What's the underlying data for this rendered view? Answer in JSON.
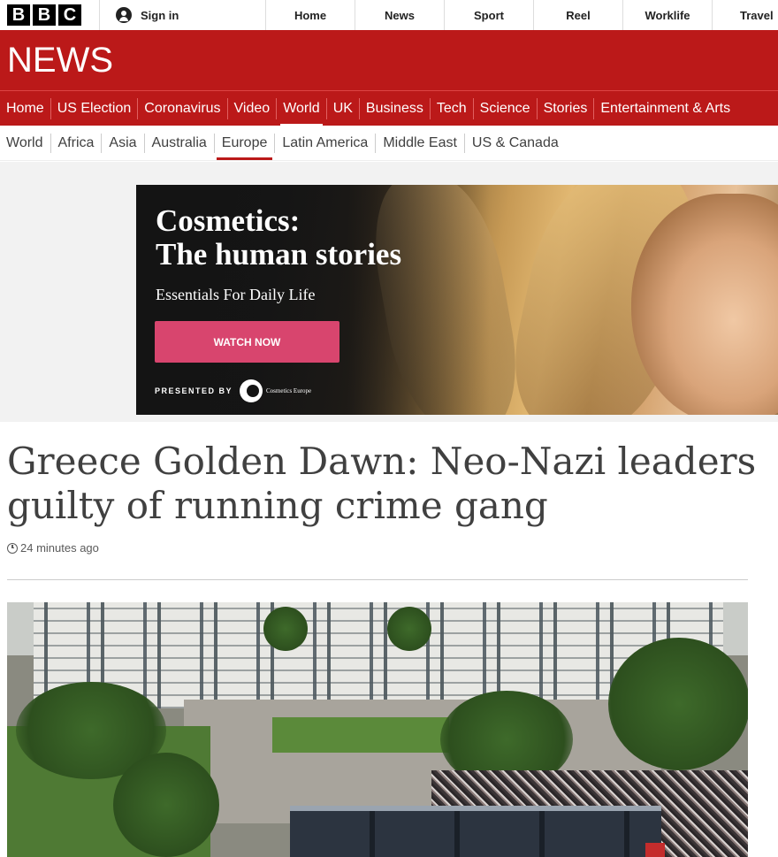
{
  "brand": {
    "letters": [
      "B",
      "B",
      "C"
    ]
  },
  "top_bar": {
    "sign_in": "Sign in",
    "nav": [
      "Home",
      "News",
      "Sport",
      "Reel",
      "Worklife",
      "Travel"
    ]
  },
  "banner": {
    "title": "NEWS"
  },
  "primary_nav": {
    "items": [
      "Home",
      "US Election",
      "Coronavirus",
      "Video",
      "World",
      "UK",
      "Business",
      "Tech",
      "Science",
      "Stories",
      "Entertainment & Arts"
    ],
    "active": "World"
  },
  "secondary_nav": {
    "items": [
      "World",
      "Africa",
      "Asia",
      "Australia",
      "Europe",
      "Latin America",
      "Middle East",
      "US & Canada"
    ],
    "active": "Europe"
  },
  "ad": {
    "title_line1": "Cosmetics:",
    "title_line2": "The human stories",
    "subtitle": "Essentials For Daily Life",
    "cta": "WATCH NOW",
    "presented_by": "PRESENTED BY",
    "sponsor": "Cosmetics Europe",
    "cta_color": "#d8456e"
  },
  "article": {
    "headline": "Greece Golden Dawn: Neo-Nazi leaders guilty of running crime gang",
    "timestamp": "24 minutes ago"
  },
  "colors": {
    "brand_red": "#bb1919"
  }
}
